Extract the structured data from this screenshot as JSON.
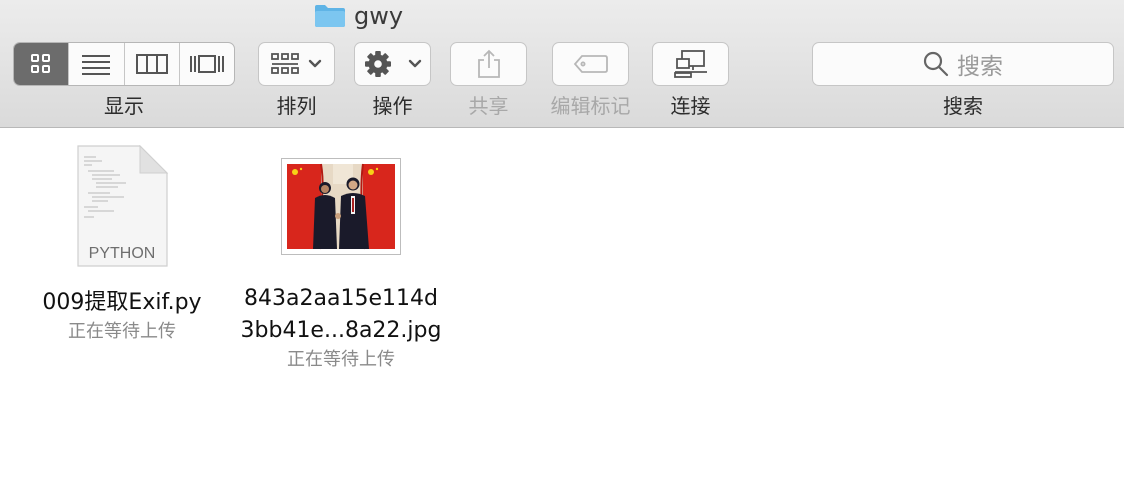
{
  "window": {
    "title": "gwy",
    "title_icon": "folder-icon"
  },
  "toolbar": {
    "view_label": "显示",
    "view_modes": [
      "icon-view-icon",
      "list-view-icon",
      "column-view-icon",
      "coverflow-view-icon"
    ],
    "arrange_label": "排列",
    "action_label": "操作",
    "share_label": "共享",
    "tags_label": "编辑标记",
    "connect_label": "连接",
    "search_label": "搜索",
    "search_placeholder": "搜索"
  },
  "files": [
    {
      "name_line1": "009提取Exif.py",
      "name_line2": "",
      "status": "正在等待上传",
      "icon_text": "PYTHON"
    },
    {
      "name_line1": "843a2aa15e114d",
      "name_line2": "3bb41e...8a22.jpg",
      "status": "正在等待上传"
    }
  ],
  "colors": {
    "folder": "#5fb4e6",
    "active_segment": "#6c6c6c",
    "flag_red": "#d8261c"
  }
}
